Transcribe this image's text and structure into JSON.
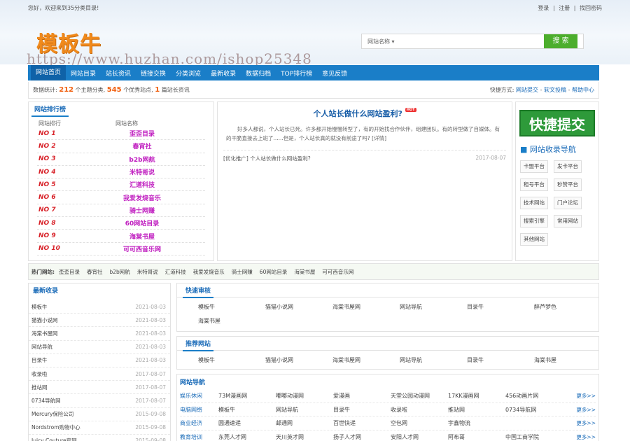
{
  "header": {
    "welcome": "您好，欢迎来到35分类目录!",
    "links": [
      "登录",
      "|",
      "注册",
      "|",
      "找回密码"
    ],
    "logo_text": "模板牛",
    "watermark": "https://www.huzhan.com/ishop25348"
  },
  "search": {
    "select_label": "网站名称 ▾",
    "button_label": "搜 索"
  },
  "nav": {
    "items": [
      "网站首页",
      "网站目录",
      "站长资讯",
      "链接交换",
      "分类浏览",
      "最新收录",
      "数据归档",
      "TOP排行榜",
      "意见反馈"
    ]
  },
  "stats": {
    "prefix": "数据统计:",
    "topics": "212",
    "topics_suffix": "个主题分类,",
    "sites": "545",
    "sites_suffix": "个优秀站点,",
    "news": "1",
    "news_suffix": "篇站长资讯",
    "quick_prefix": "快捷方式:",
    "quick_links": [
      "网站提交",
      " - ",
      "软文投稿",
      " - ",
      "帮助中心"
    ]
  },
  "ranking": {
    "title": "网站排行榜",
    "col1": "网站排行",
    "col2": "网站名称",
    "rows": [
      {
        "no": "NO 1",
        "name": "歪歪目录"
      },
      {
        "no": "NO 2",
        "name": "春宵社"
      },
      {
        "no": "NO 3",
        "name": "b2b网航"
      },
      {
        "no": "NO 4",
        "name": "米特哥说"
      },
      {
        "no": "NO 5",
        "name": "汇道科技"
      },
      {
        "no": "NO 6",
        "name": "我爱发烧音乐"
      },
      {
        "no": "NO 7",
        "name": "骑士网赚"
      },
      {
        "no": "NO 8",
        "name": "60网站目录"
      },
      {
        "no": "NO 9",
        "name": "海棠书屋"
      },
      {
        "no": "NO 10",
        "name": "可可西音乐网"
      }
    ]
  },
  "article": {
    "title": "个人站长做什么网站盈利?",
    "hot": "HOT",
    "body": "好多人都说，个人站长已死。许多都开始慢慢转型了，有的开始找合作伙伴，组建团队。有的转型做了自媒体。有的干脆直接去上班了......但是，个人站长真的就没有前途了吗? [详情]",
    "list_item": "[优化推广] 个人站长做什么网站盈利?",
    "list_date": "2017-08-07"
  },
  "sidebar": {
    "submit_label": "快捷提交",
    "category_title": "网站收录导航",
    "categories": [
      "卡盟平台",
      "发卡平台",
      "租号平台",
      "秒赞平台",
      "技术网站",
      "门户论坛",
      "搜索引擎",
      "常用网站",
      "其他网站"
    ]
  },
  "hotsites": {
    "label": "热门网站:",
    "items": [
      "歪歪目录",
      "春宵社",
      "b2b网航",
      "米特哥说",
      "汇道科技",
      "我爱发烧音乐",
      "骑士网赚",
      "60网站目录",
      "海棠书屋",
      "可可西音乐网"
    ]
  },
  "latest": {
    "title": "最新收录",
    "rows": [
      {
        "name": "模板牛",
        "date": "2021-08-03"
      },
      {
        "name": "猫猫小说网",
        "date": "2021-08-03"
      },
      {
        "name": "海棠书屋网",
        "date": "2021-08-03"
      },
      {
        "name": "网站导航",
        "date": "2021-08-03"
      },
      {
        "name": "目录牛",
        "date": "2021-08-03"
      },
      {
        "name": "收录啦",
        "date": "2017-08-07"
      },
      {
        "name": "推站网",
        "date": "2017-08-07"
      },
      {
        "name": "0734导航网",
        "date": "2017-08-07"
      },
      {
        "name": "Mercury保险公司",
        "date": "2015-09-08"
      },
      {
        "name": "Nordstrom购物中心",
        "date": "2015-09-08"
      },
      {
        "name": "Juicy Couture官网",
        "date": "2015-09-08"
      }
    ]
  },
  "quick_audit": {
    "title": "快速审核",
    "items": [
      "模板牛",
      "猫猫小说网",
      "海棠书屋网",
      "网站导航",
      "目录牛",
      "醉芦梦色",
      "海棠书屋"
    ]
  },
  "recommended": {
    "title": "推荐网站",
    "items": [
      "模板牛",
      "猫猫小说网",
      "海棠书屋网",
      "网站导航",
      "目录牛",
      "海棠书屋"
    ]
  },
  "directory": {
    "title": "网站导航",
    "rows": [
      {
        "cat": "娱乐休闲",
        "items": [
          "73M漫画网",
          "嘟嘟动漫网",
          "爱漫画",
          "天堂公园动漫网",
          "17KK漫画网",
          "456动画片网"
        ],
        "more": "更多>>"
      },
      {
        "cat": "电脑网络",
        "items": [
          "模板牛",
          "网站导航",
          "目录牛",
          "收录啦",
          "推站网",
          "0734导航网"
        ],
        "more": "更多>>"
      },
      {
        "cat": "商业经济",
        "items": [
          "圆通速递",
          "邮通网",
          "百世快递",
          "空包网",
          "宇鑫物流"
        ],
        "more": "更多>>"
      },
      {
        "cat": "教育培训",
        "items": [
          "东莞人才网",
          "天川英才网",
          "扬子人才网",
          "安阳人才网",
          "阿布哥",
          "中国工商学院"
        ],
        "more": "更多>>"
      }
    ]
  }
}
